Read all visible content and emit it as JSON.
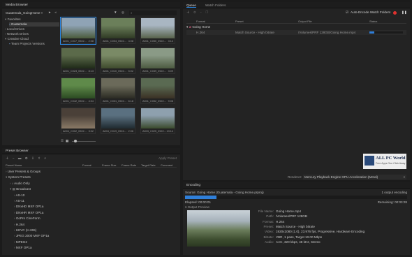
{
  "media_browser": {
    "title": "Media Browser",
    "location": "Guatemala_GoingHome",
    "tree": [
      {
        "label": "Favorites",
        "indent": 0,
        "open": true
      },
      {
        "label": "Guatemala",
        "indent": 1,
        "selected": true
      },
      {
        "label": "Local Drives",
        "indent": 0,
        "open": false
      },
      {
        "label": "Network Drives",
        "indent": 0,
        "open": false
      },
      {
        "label": "Creative Cloud",
        "indent": 0,
        "open": true
      },
      {
        "label": "Team Projects Versions",
        "indent": 1
      }
    ],
    "thumbnails": [
      {
        "name": "A001_C017_0922...",
        "dur": "2:08",
        "c1": "#8fa3b5",
        "c2": "#4a5a3a"
      },
      {
        "name": "A001_C004_0922...",
        "dur": "4:08",
        "c1": "#6b7f5a",
        "c2": "#2f3a24"
      },
      {
        "name": "A001_C050_0922...",
        "dur": "3:14",
        "c1": "#a9b6c2",
        "c2": "#57624a"
      },
      {
        "name": "A001_C023_0922...",
        "dur": "8:13",
        "c1": "#5b6a4a",
        "c2": "#1f2a18"
      },
      {
        "name": "A001_C010_0922...",
        "dur": "5:02",
        "c1": "#7a8a66",
        "c2": "#3e4a2c"
      },
      {
        "name": "A001_C039_0922...",
        "dur": "3:09",
        "c1": "#8a9a86",
        "c2": "#4c5a40"
      },
      {
        "name": "A001_C042_0922...",
        "dur": "4:04",
        "c1": "#5f8a4a",
        "c2": "#2b4a22"
      },
      {
        "name": "A001_C031_0922...",
        "dur": "6:18",
        "c1": "#6b6a5a",
        "c2": "#2a2a22"
      },
      {
        "name": "A001_C052_0922...",
        "dur": "9:08",
        "c1": "#5a6a52",
        "c2": "#3a3024"
      },
      {
        "name": "A004_C002_0922...",
        "dur": "3:02",
        "c1": "#4a4038",
        "c2": "#8a7a66"
      },
      {
        "name": "A004_C019_0924...",
        "dur": "2:06",
        "c1": "#5a7080",
        "c2": "#1f2a30"
      },
      {
        "name": "A003_C025_0922...",
        "dur": "13:14",
        "c1": "#8ea0ae",
        "c2": "#3a4a2c"
      }
    ]
  },
  "preset_browser": {
    "title": "Preset Browser",
    "apply_label": "Apply Preset",
    "columns": [
      "Preset Name",
      "Format",
      "Frame Size",
      "Frame Rate",
      "Target Rate",
      "Comment"
    ],
    "rows": [
      {
        "label": "User Presets & Groups",
        "indent": 0,
        "open": false
      },
      {
        "label": "System Presets",
        "indent": 0,
        "open": true
      },
      {
        "label": "Audio Only",
        "indent": 1,
        "open": false
      },
      {
        "label": "Broadcast",
        "indent": 1,
        "open": true
      },
      {
        "label": "AS-10",
        "indent": 2
      },
      {
        "label": "AS-11",
        "indent": 2
      },
      {
        "label": "DNxHD MXF OP1a",
        "indent": 2
      },
      {
        "label": "DNxHR MXF OP1a",
        "indent": 2
      },
      {
        "label": "GoPro CineForm",
        "indent": 2
      },
      {
        "label": "H.264",
        "indent": 2
      },
      {
        "label": "HEVC (H.265)",
        "indent": 2
      },
      {
        "label": "JPEG 2000 MXF OP1a",
        "indent": 2
      },
      {
        "label": "MPEG2",
        "indent": 2
      },
      {
        "label": "MXF OP1a",
        "indent": 2
      }
    ]
  },
  "queue": {
    "tabs": [
      "Queue",
      "Watch Folders"
    ],
    "auto_encode_label": "Auto-Encode Watch Folders",
    "columns": [
      "Format",
      "Preset",
      "Output File",
      "Status"
    ],
    "group_label": "Going Home",
    "item": {
      "format": "H.264",
      "preset": "Match Source - High bitrate",
      "output": "/Volumes/PRF 128GB/Going Home.mp4"
    },
    "renderer_label": "Renderer:",
    "renderer_value": "Mercury Playback Engine GPU Acceleration (Metal)"
  },
  "encoding": {
    "title": "Encoding",
    "source": "Source: Going Home (Guatemala - Going Home.prproj)",
    "count": "1 output encoding",
    "progress": 0.14,
    "elapsed": "Elapsed: 00:00:01",
    "remaining": "Remaining: 00:03:28",
    "preview_label": "Output Preview",
    "details": [
      {
        "k": "File Name:",
        "v": "Going Home.mp4"
      },
      {
        "k": "Path:",
        "v": "/Volumes/PRF 128GB"
      },
      {
        "k": "Format:",
        "v": "H.264"
      },
      {
        "k": "Preset:",
        "v": "Match Source - High bitrate"
      },
      {
        "k": "Video:",
        "v": "1920x1080 (1.0), 23.976 fps, Progressive, Hardware Encoding"
      },
      {
        "k": "Bitrate:",
        "v": "VBR, 1 pass, Target 10.00 Mbps"
      },
      {
        "k": "Audio:",
        "v": "AAC, 320 kbps, 48 kHz, Stereo"
      }
    ]
  },
  "watermark": {
    "title": "ALL PC World",
    "subtitle": "Free Apps One Click Away"
  },
  "colors": {
    "accent": "#2d8ceb",
    "progress": "#2f7fd9",
    "record": "#e0322f"
  }
}
